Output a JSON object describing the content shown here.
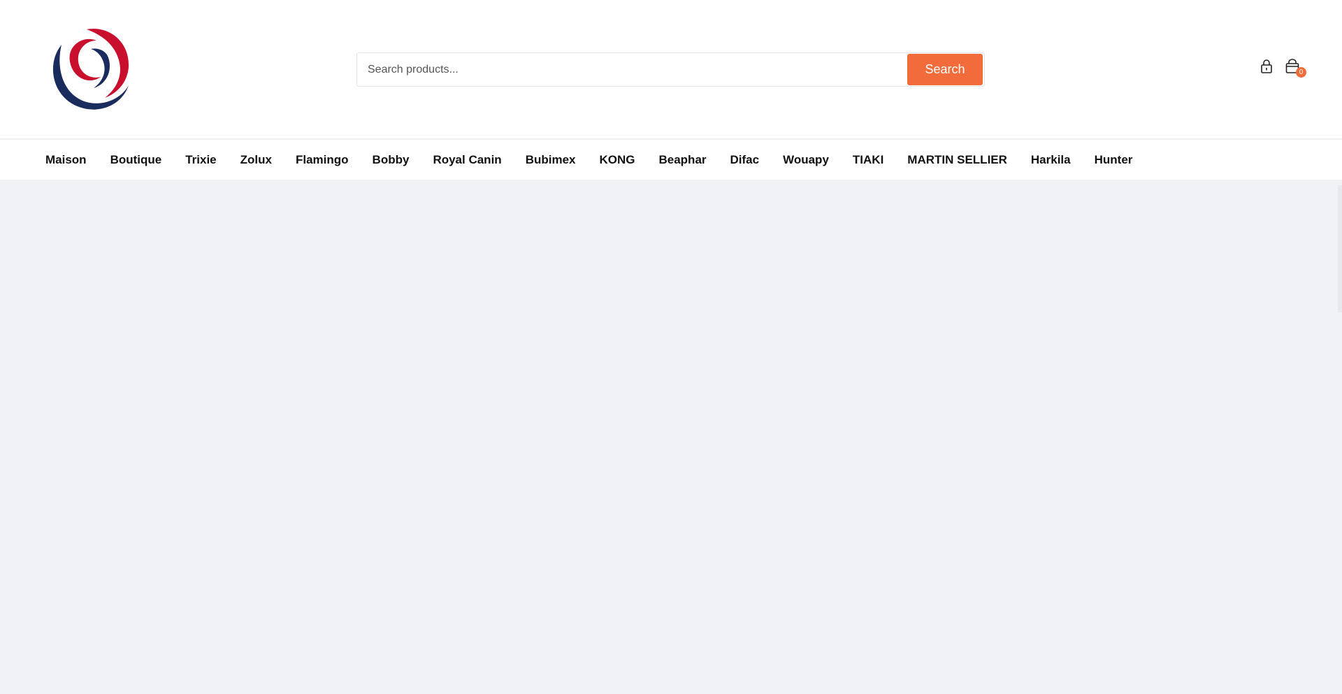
{
  "header": {
    "logo": {
      "colors": {
        "red": "#c8102e",
        "navy": "#1a2b5e"
      }
    },
    "search": {
      "placeholder": "Search products...",
      "button_label": "Search",
      "accent": "#f26b3a"
    },
    "cart": {
      "count": "0"
    },
    "icons": [
      "lock-icon",
      "cart-icon"
    ]
  },
  "nav": {
    "items": [
      {
        "label": "Maison"
      },
      {
        "label": "Boutique"
      },
      {
        "label": "Trixie"
      },
      {
        "label": "Zolux"
      },
      {
        "label": "Flamingo"
      },
      {
        "label": "Bobby"
      },
      {
        "label": "Royal Canin"
      },
      {
        "label": "Bubimex"
      },
      {
        "label": "KONG"
      },
      {
        "label": "Beaphar"
      },
      {
        "label": "Difac"
      },
      {
        "label": "Wouapy"
      },
      {
        "label": "TIAKI"
      },
      {
        "label": "MARTIN SELLIER"
      },
      {
        "label": "Harkila"
      },
      {
        "label": "Hunter"
      }
    ]
  }
}
